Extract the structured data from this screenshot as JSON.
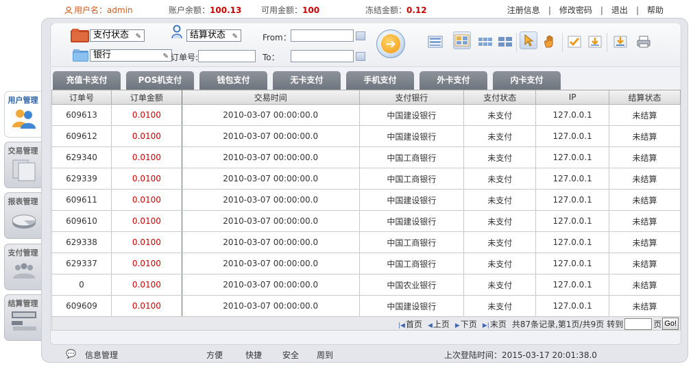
{
  "topbar": {
    "user_label": "用户名：",
    "username": "admin",
    "balance_label": "账户余额：",
    "balance_value": "100.13",
    "available_label": "可用金额：",
    "available_value": "100",
    "frozen_label": "冻结金额：",
    "frozen_value": "0.12",
    "links": [
      "注册信息",
      "修改密码",
      "退出",
      "帮助"
    ]
  },
  "toolbar": {
    "pay_status_select": "支付状态",
    "settle_status_select": "结算状态",
    "bank_select": "银行",
    "order_label": "订单号:",
    "order_value": "",
    "from_label": "From：",
    "from_value": "",
    "to_label": "To：",
    "to_value": ""
  },
  "tabs": [
    "充值卡支付",
    "POS机支付",
    "钱包支付",
    "无卡支付",
    "手机支付",
    "外卡支付",
    "内卡支付"
  ],
  "table": {
    "columns": [
      "订单号",
      "订单金额",
      "交易时间",
      "支付银行",
      "支付状态",
      "IP",
      "结算状态"
    ],
    "rows": [
      [
        "609613",
        "0.0100",
        "2010-03-07 00:00:00.0",
        "中国建设银行",
        "未支付",
        "127.0.0.1",
        "未结算"
      ],
      [
        "609612",
        "0.0100",
        "2010-03-07 00:00:00.0",
        "中国建设银行",
        "未支付",
        "127.0.0.1",
        "未结算"
      ],
      [
        "629340",
        "0.0100",
        "2010-03-07 00:00:00.0",
        "中国工商银行",
        "未支付",
        "127.0.0.1",
        "未结算"
      ],
      [
        "629339",
        "0.0100",
        "2010-03-07 00:00:00.0",
        "中国工商银行",
        "未支付",
        "127.0.0.1",
        "未结算"
      ],
      [
        "609611",
        "0.0100",
        "2010-03-07 00:00:00.0",
        "中国建设银行",
        "未支付",
        "127.0.0.1",
        "未结算"
      ],
      [
        "609610",
        "0.0100",
        "2010-03-07 00:00:00.0",
        "中国建设银行",
        "未支付",
        "127.0.0.1",
        "未结算"
      ],
      [
        "629338",
        "0.0100",
        "2010-03-07 00:00:00.0",
        "中国工商银行",
        "未支付",
        "127.0.0.1",
        "未结算"
      ],
      [
        "629337",
        "0.0100",
        "2010-03-07 00:00:00.0",
        "中国工商银行",
        "未支付",
        "127.0.0.1",
        "未结算"
      ],
      [
        "0",
        "0.0100",
        "2010-03-07 00:00:00.0",
        "中国农业银行",
        "未支付",
        "127.0.0.1",
        "未结算"
      ],
      [
        "609609",
        "0.0100",
        "2010-03-07 00:00:00.0",
        "中国建设银行",
        "未支付",
        "127.0.0.1",
        "未结算"
      ]
    ]
  },
  "pager": {
    "first": "首页",
    "prev": "上页",
    "next": "下页",
    "last": "末页",
    "summary": "共87条记录,第1页/共9页",
    "goto_label": "转到",
    "page_unit": "页",
    "go_button": "Go!"
  },
  "sidebar": {
    "items": [
      "用户管理",
      "交易管理",
      "报表管理",
      "支付管理",
      "结算管理"
    ]
  },
  "footer": {
    "info": "信息管理",
    "words": [
      "方便",
      "快捷",
      "安全",
      "周到"
    ],
    "last_login": "上次登陆时间：2015-03-17 20:01:38.0"
  }
}
